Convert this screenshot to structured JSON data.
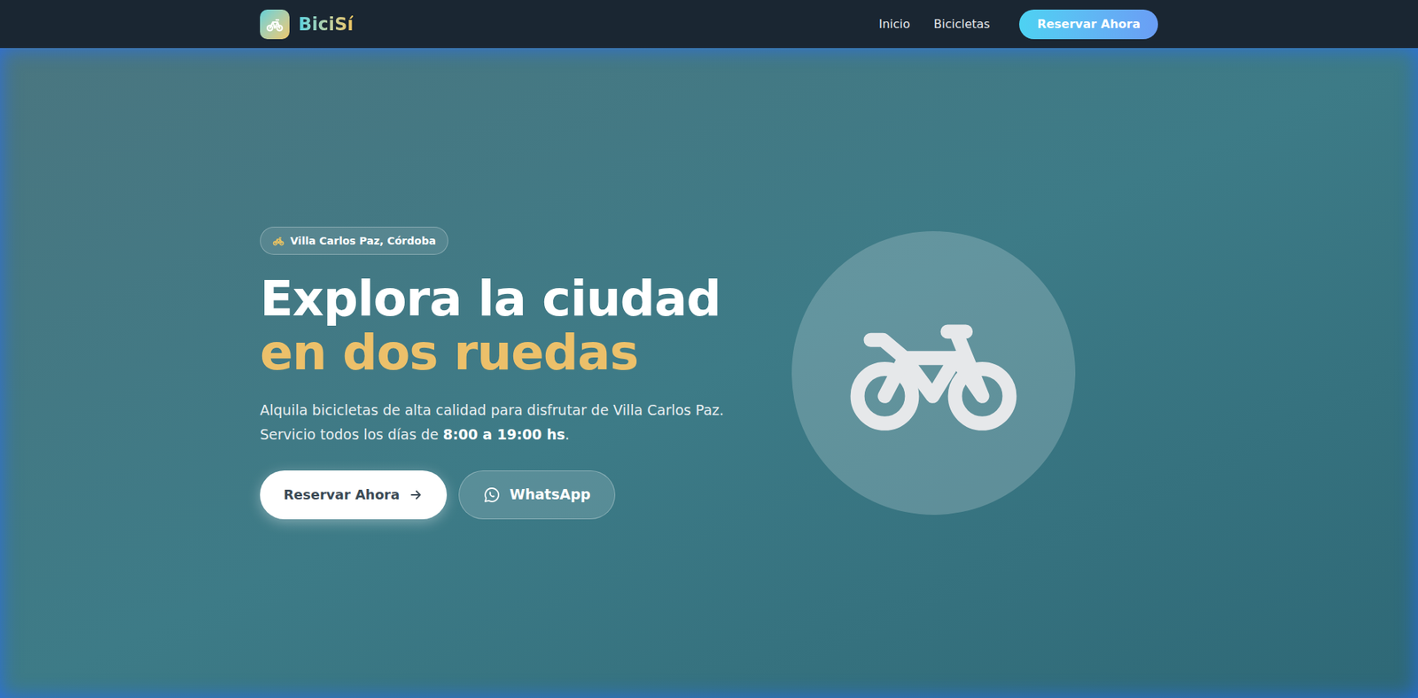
{
  "nav": {
    "brand": "BiciSí",
    "links": [
      "Inicio",
      "Bicicletas"
    ],
    "cta": "Reservar Ahora"
  },
  "hero": {
    "badge": "Villa Carlos Paz, Córdoba",
    "title_line1": "Explora la ciudad",
    "title_line2": "en dos ruedas",
    "description_line1": "Alquila bicicletas de alta calidad para disfrutar de Villa Carlos Paz.",
    "description_line2": [
      "Servicio todos los días de ",
      "8:00 a 19:00 hs",
      "."
    ],
    "primary_button": "Reservar Ahora",
    "secondary_button": "WhatsApp"
  }
}
